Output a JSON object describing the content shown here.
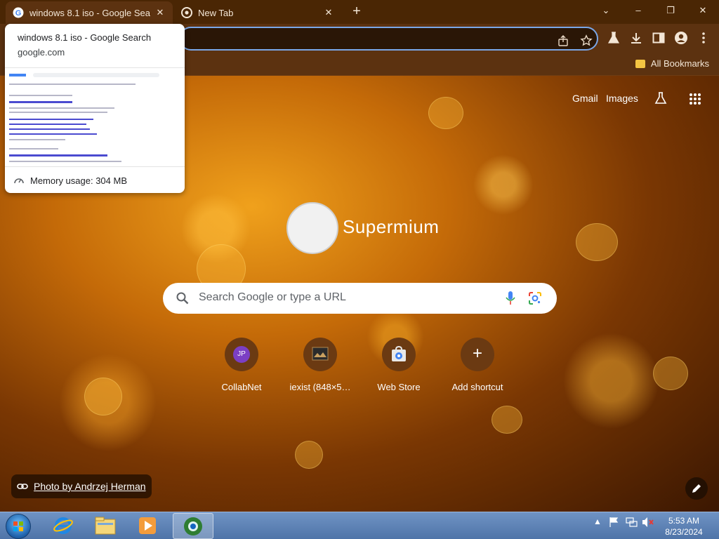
{
  "tabs": [
    {
      "title": "windows 8.1 iso - Google Search",
      "active": true
    },
    {
      "title": "New Tab",
      "active": false
    }
  ],
  "window_controls": {
    "tab_search": "⌄",
    "minimize": "–",
    "restore": "❐",
    "close": "✕"
  },
  "bookmarks_bar": {
    "all_bookmarks": "All Bookmarks"
  },
  "hover_card": {
    "title": "windows 8.1 iso - Google Search",
    "domain": "google.com",
    "memory": "Memory usage: 304 MB"
  },
  "ntp": {
    "gmail": "Gmail",
    "images": "Images",
    "logo_text": "Supermium",
    "search_placeholder": "Search Google or type a URL",
    "shortcuts": [
      {
        "label": "CollabNet",
        "icon_text": "JP"
      },
      {
        "label": "iexist (848×5…",
        "icon_text": ""
      },
      {
        "label": "Web Store",
        "icon_text": ""
      },
      {
        "label": "Add shortcut",
        "icon_text": "+"
      }
    ],
    "photo_credit": "Photo by Andrzej Herman"
  },
  "taskbar": {
    "time": "5:53 AM",
    "date": "8/23/2024"
  },
  "colors": {
    "tabstrip": "#4a2604",
    "toolbar": "#5c3210",
    "omnibox_border": "#7aa7e8",
    "collabnet_icon": "#7b3fc4"
  }
}
